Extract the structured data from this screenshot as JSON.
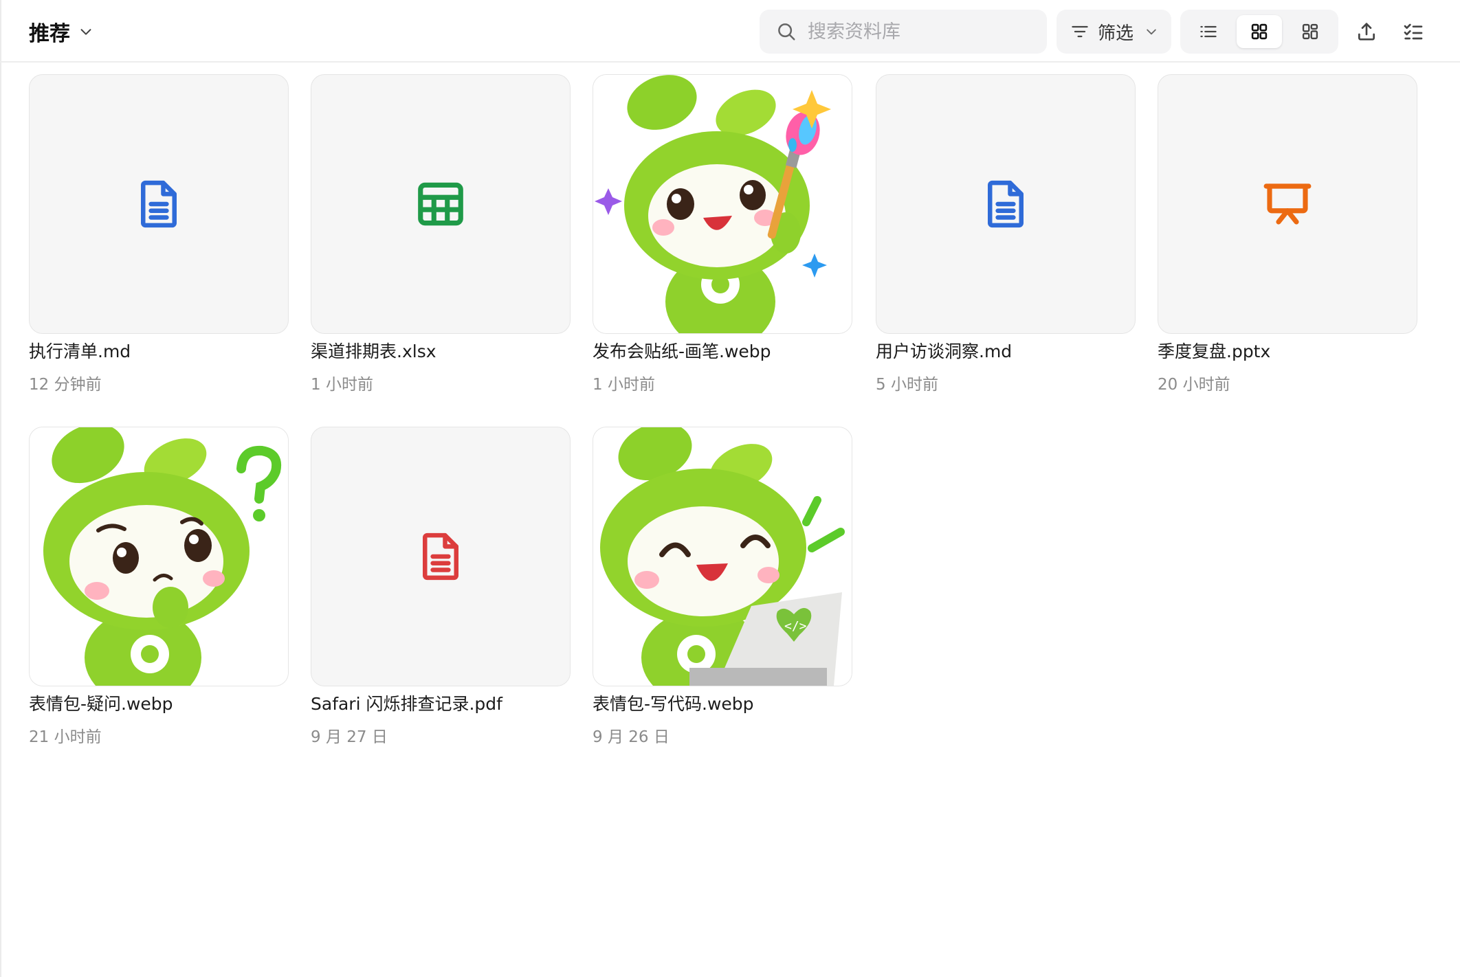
{
  "header": {
    "title": "推荐",
    "search_placeholder": "搜索资料库",
    "filter_label": "筛选"
  },
  "files": [
    {
      "name": "执行清单.md",
      "time": "12 分钟前",
      "type": "doc",
      "icon": "document-icon",
      "color": "#2f6bd8"
    },
    {
      "name": "渠道排期表.xlsx",
      "time": "1 小时前",
      "type": "sheet",
      "icon": "spreadsheet-icon",
      "color": "#1f9a48"
    },
    {
      "name": "发布会贴纸-画笔.webp",
      "time": "1 小时前",
      "type": "image",
      "icon": "mascot-painter-image"
    },
    {
      "name": "用户访谈洞察.md",
      "time": "5 小时前",
      "type": "doc",
      "icon": "document-icon",
      "color": "#2f6bd8"
    },
    {
      "name": "季度复盘.pptx",
      "time": "20 小时前",
      "type": "slides",
      "icon": "presentation-icon",
      "color": "#ec6a12"
    },
    {
      "name": "表情包-疑问.webp",
      "time": "21 小时前",
      "type": "image",
      "icon": "mascot-question-image"
    },
    {
      "name": "Safari 闪烁排查记录.pdf",
      "time": "9 月 27 日",
      "type": "pdf",
      "icon": "pdf-document-icon",
      "color": "#dc3d3d"
    },
    {
      "name": "表情包-写代码.webp",
      "time": "9 月 26 日",
      "type": "image",
      "icon": "mascot-coding-image"
    }
  ]
}
